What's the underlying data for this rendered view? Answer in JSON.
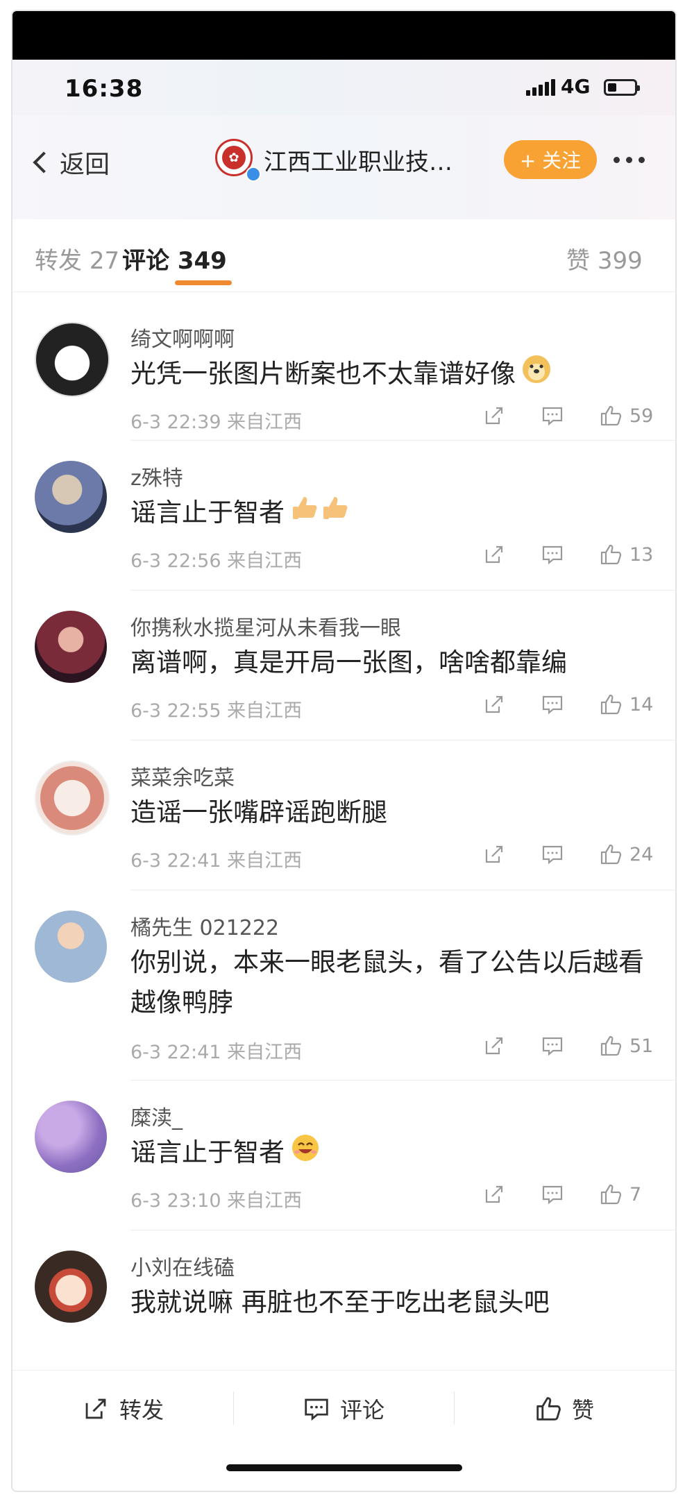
{
  "status_bar": {
    "time": "16:38",
    "network": "4G"
  },
  "nav": {
    "back_label": "返回",
    "title": "江西工业职业技…",
    "follow_label": "+ 关注"
  },
  "tabs": [
    {
      "label": "转发",
      "count": "27"
    },
    {
      "label": "评论",
      "count": "349"
    },
    {
      "label": "赞",
      "count": "399"
    }
  ],
  "comments": [
    {
      "username": "绮文啊啊啊",
      "text": "光凭一张图片断案也不太靠谱好像",
      "date": "6-3 22:39",
      "location": "来自江西",
      "likes": "59",
      "emoji": "doge"
    },
    {
      "username": "z殊特",
      "text": "谣言止于智者",
      "date": "6-3 22:56",
      "location": "来自江西",
      "likes": "13",
      "emoji": "thumbs-up"
    },
    {
      "username": "你携秋水揽星河从未看我一眼",
      "text": "离谱啊，真是开局一张图，啥啥都靠编",
      "date": "6-3 22:55",
      "location": "来自江西",
      "likes": "14"
    },
    {
      "username": "菜菜余吃菜",
      "text": "造谣一张嘴辟谣跑断腿",
      "date": "6-3 22:41",
      "location": "来自江西",
      "likes": "24"
    },
    {
      "username": "橘先生 021222",
      "text": "你别说，本来一眼老鼠头，看了公告以后越看越像鸭脖",
      "date": "6-3 22:41",
      "location": "来自江西",
      "likes": "51"
    },
    {
      "username": "糜渎_",
      "text": "谣言止于智者",
      "date": "6-3 23:10",
      "location": "来自江西",
      "likes": "7",
      "emoji": "smile"
    },
    {
      "username": "小刘在线磕",
      "text": "我就说嘛 再脏也不至于吃出老鼠头吧",
      "date": "",
      "location": "",
      "likes": ""
    }
  ],
  "bottom_bar": {
    "repost_label": "转发",
    "comment_label": "评论",
    "like_label": "赞"
  },
  "colors": {
    "accent_orange": "#f7a233",
    "tab_underline": "#f08a30"
  }
}
